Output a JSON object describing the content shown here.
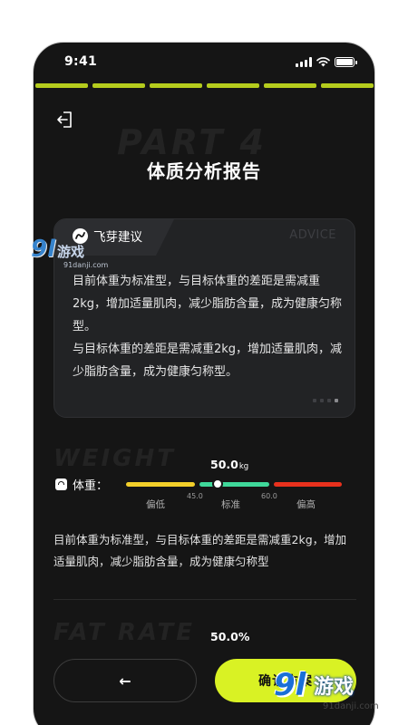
{
  "status_bar": {
    "time": "9:41"
  },
  "progress": [
    {
      "state": "done"
    },
    {
      "state": "done"
    },
    {
      "state": "done"
    },
    {
      "state": "done"
    },
    {
      "state": "done"
    },
    {
      "state": "done"
    },
    {
      "state": "current"
    },
    {
      "state": "todo"
    }
  ],
  "page": {
    "bg_word": "PART 4",
    "title": "体质分析报告"
  },
  "advice": {
    "label": "飞芽建议",
    "en_label": "ADVICE",
    "paragraph_1": "目前体重为标准型，与目标体重的差距是需减重2kg，增加适量肌肉，减少脂肪含量，成为健康匀称型。",
    "paragraph_2": "与目标体重的差距是需减重2kg，增加适量肌肉，减少脂肪含量，成为健康匀称型。",
    "page_indicator": {
      "count": 4,
      "active": 3
    }
  },
  "weight": {
    "bg_word": "WEIGHT",
    "label": "体重：",
    "value": "50.0",
    "unit": "kg",
    "level": 0.6,
    "scale": {
      "low_label": "偏低",
      "normal_label": "标准",
      "high_label": "偏高",
      "threshold_low": "45.0",
      "threshold_high": "60.0"
    },
    "description": "目前体重为标准型，与目标体重的差距是需减重2kg，增加适量肌肉，减少脂肪含量，成为健康匀称型"
  },
  "fat_rate": {
    "bg_word": "FAT RATE",
    "value": "50.0%"
  },
  "buttons": {
    "back_arrow": "←",
    "confirm_label": "确认方案"
  },
  "watermarks": {
    "small": {
      "mark": "9l",
      "text": "游戏",
      "url": "91danji.com"
    },
    "big": {
      "mark": "9l",
      "text": "游戏",
      "url": "91danji.com"
    }
  },
  "colors": {
    "accent": "#d9f224",
    "progress_done": "#b5cc1d",
    "progress_current": "#b9b9b9",
    "progress_todo": "#3a3a3a",
    "scale_low": "#f3cf2a",
    "scale_normal": "#3fd89a",
    "scale_high": "#e8311d"
  },
  "icons": {
    "back": "exit-arrow-icon",
    "advice_logo": "feiya-logo-icon",
    "weight": "scale-icon",
    "arrow_left": "arrow-left-icon"
  }
}
